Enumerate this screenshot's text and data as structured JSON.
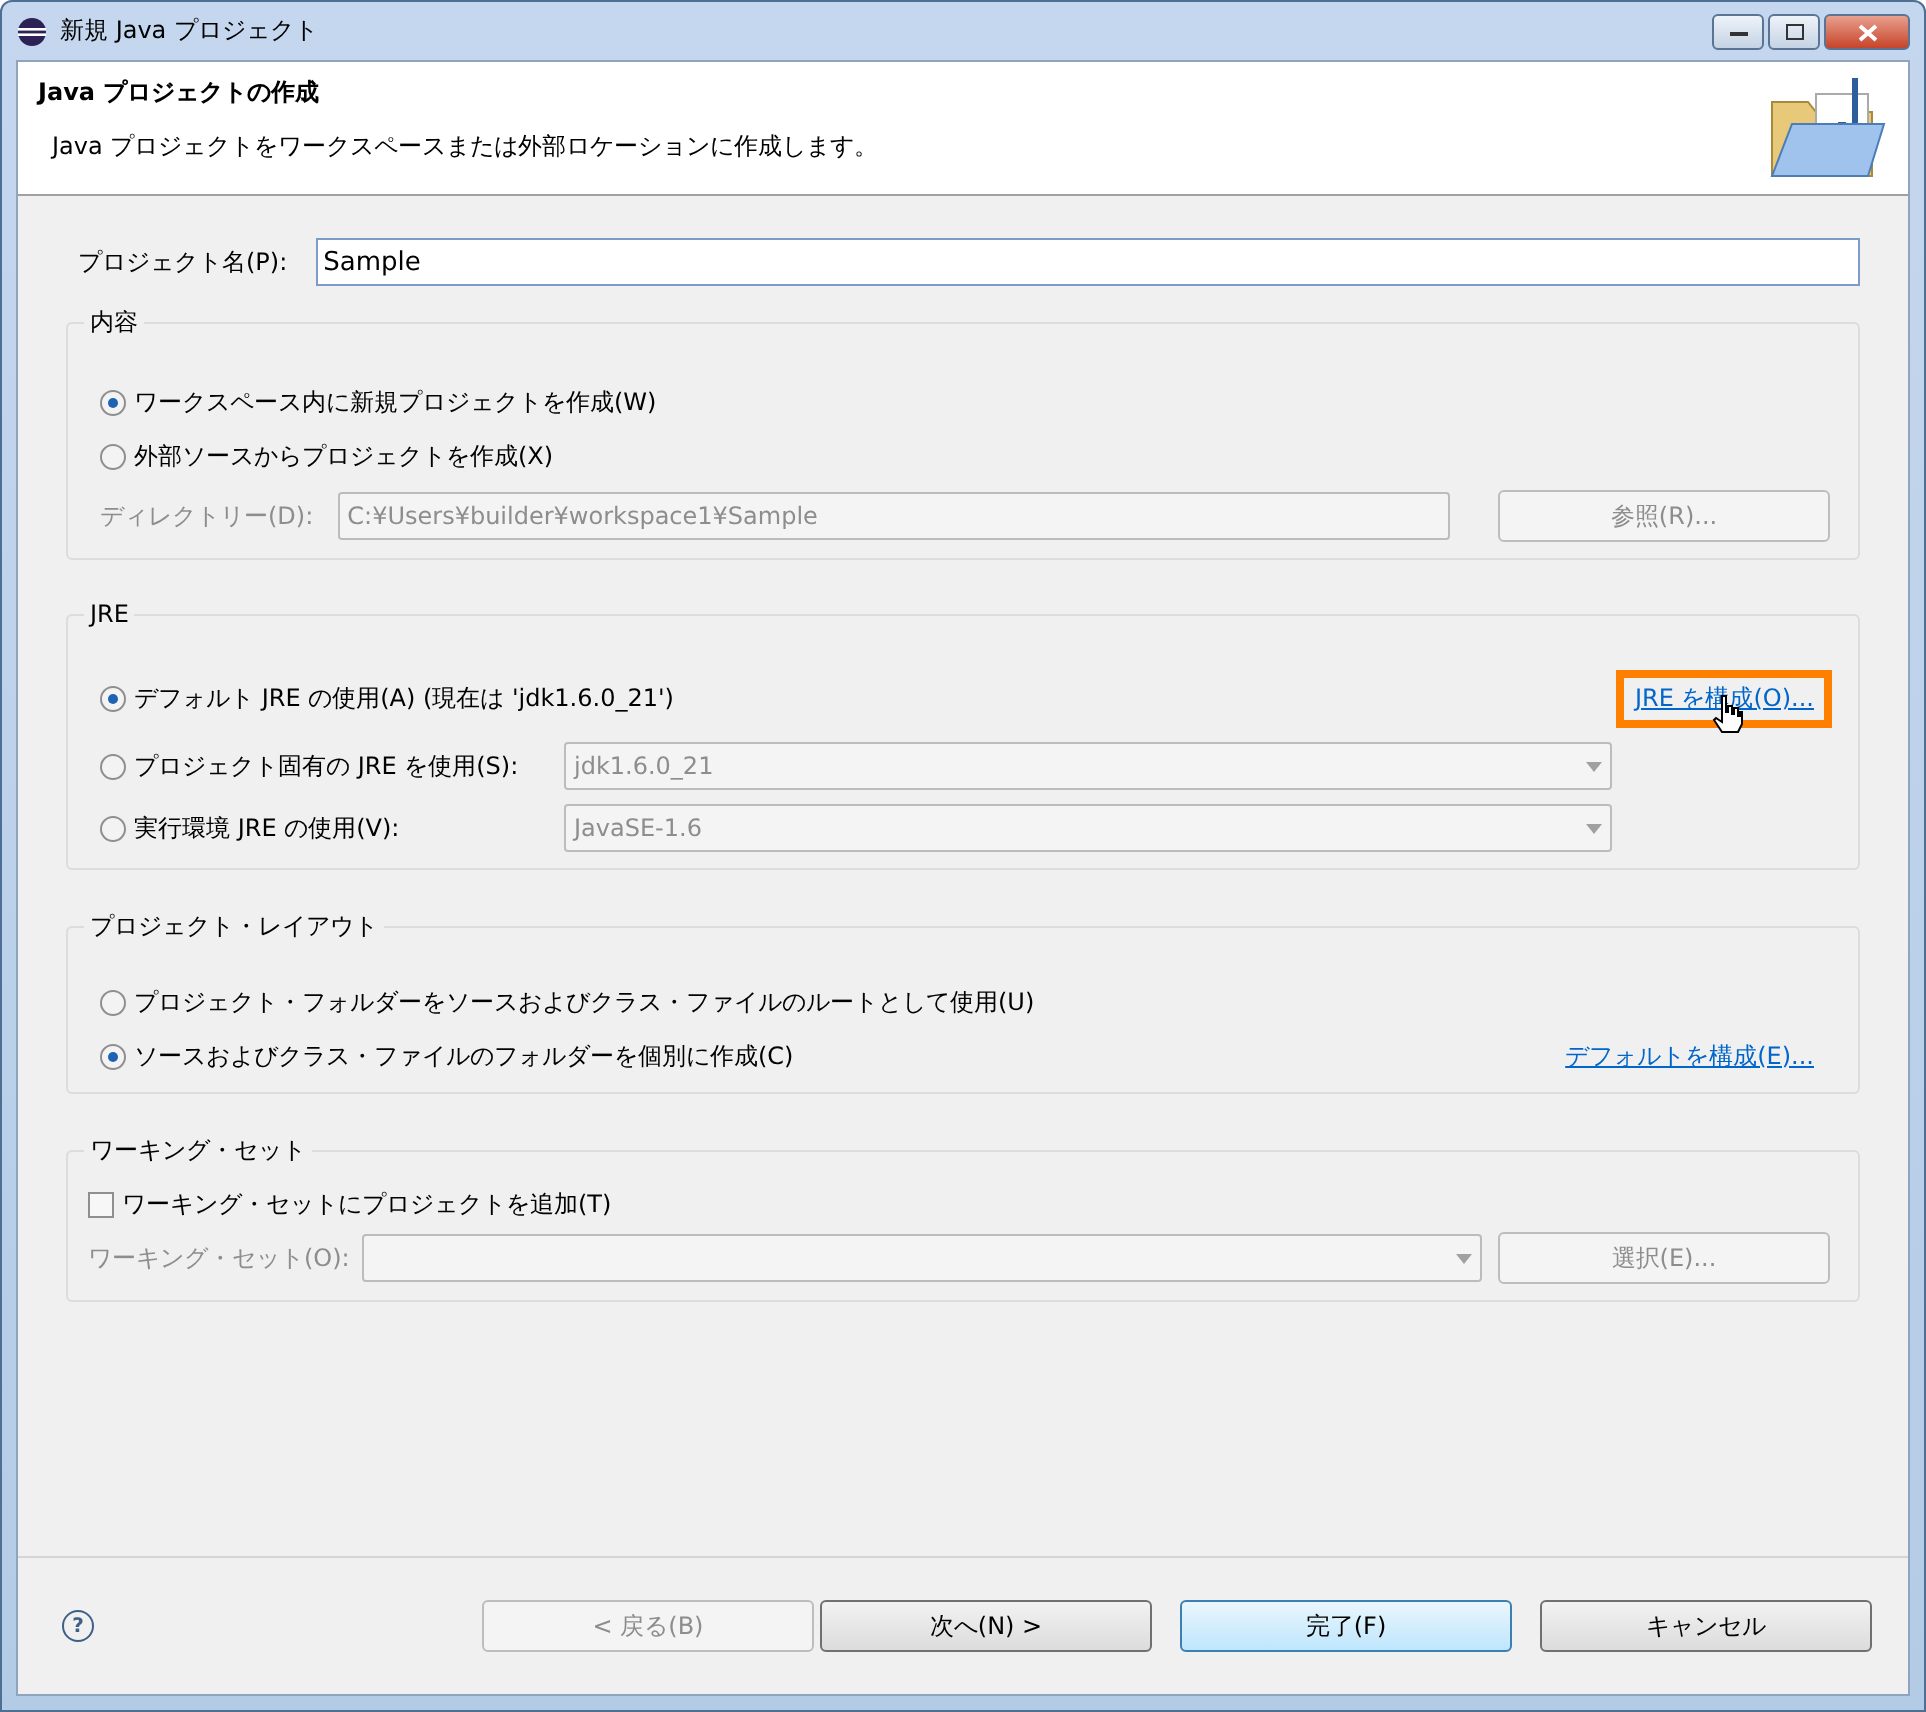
{
  "window": {
    "title": "新規 Java プロジェクト"
  },
  "header": {
    "title": "Java プロジェクトの作成",
    "description": "Java プロジェクトをワークスペースまたは外部ロケーションに作成します。"
  },
  "project_name": {
    "label": "プロジェクト名(P):",
    "value": "Sample"
  },
  "contents": {
    "title": "内容",
    "options": [
      {
        "label": "ワークスペース内に新規プロジェクトを作成(W)",
        "selected": true
      },
      {
        "label": "外部ソースからプロジェクトを作成(X)",
        "selected": false
      }
    ],
    "directory": {
      "label": "ディレクトリー(D):",
      "value": "C:¥Users¥builder¥workspace1¥Sample",
      "disabled": true
    },
    "browse_button": {
      "label": "参照(R)...",
      "disabled": true
    }
  },
  "jre": {
    "title": "JRE",
    "options": [
      {
        "kind": "plain",
        "label": "デフォルト JRE の使用(A) (現在は 'jdk1.6.0_21')",
        "selected": true
      },
      {
        "kind": "combo",
        "label": "プロジェクト固有の JRE を使用(S):",
        "selected": false,
        "value": "jdk1.6.0_21"
      },
      {
        "kind": "combo",
        "label": "実行環境 JRE の使用(V):",
        "selected": false,
        "value": "JavaSE-1.6"
      }
    ],
    "link": {
      "label": "JRE を構成(O)...",
      "highlighted": true
    }
  },
  "layout": {
    "title": "プロジェクト・レイアウト",
    "options": [
      {
        "label": "プロジェクト・フォルダーをソースおよびクラス・ファイルのルートとして使用(U)",
        "selected": false
      },
      {
        "label": "ソースおよびクラス・ファイルのフォルダーを個別に作成(C)",
        "selected": true
      }
    ],
    "link": {
      "label": "デフォルトを構成(E)..."
    }
  },
  "working_set": {
    "title": "ワーキング・セット",
    "checkbox": {
      "label": "ワーキング・セットにプロジェクトを追加(T)",
      "checked": false
    },
    "field": {
      "label": "ワーキング・セット(O):",
      "disabled": true
    },
    "button": {
      "label": "選択(E)...",
      "disabled": true
    }
  },
  "footer": {
    "help": "?",
    "buttons": [
      {
        "label": "< 戻る(B)",
        "disabled": true,
        "default": false
      },
      {
        "label": "次へ(N) >",
        "disabled": false,
        "default": false
      },
      {
        "label": "完了(F)",
        "disabled": false,
        "default": true
      },
      {
        "label": "キャンセル",
        "disabled": false,
        "default": false
      }
    ]
  }
}
